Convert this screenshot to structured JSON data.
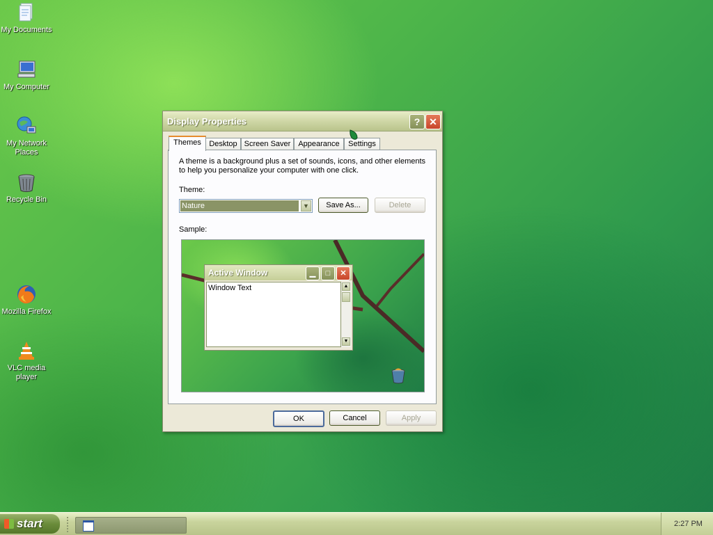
{
  "desktop": {
    "icons": [
      {
        "label": "My Documents",
        "icon": "documents-icon"
      },
      {
        "label": "My Computer",
        "icon": "computer-icon"
      },
      {
        "label_lines": [
          "My Network",
          "Places"
        ],
        "icon": "network-places-icon"
      },
      {
        "label": "Recycle Bin",
        "icon": "recycle-bin-icon"
      },
      {
        "label": "Mozilla Firefox",
        "icon": "firefox-icon"
      },
      {
        "label_lines": [
          "VLC media",
          "player"
        ],
        "icon": "vlc-icon"
      }
    ]
  },
  "dialog": {
    "title": "Display Properties",
    "help_glyph": "?",
    "close_glyph": "✕",
    "tabs": [
      "Themes",
      "Desktop",
      "Screen Saver",
      "Appearance",
      "Settings"
    ],
    "active_tab": "Themes",
    "description": "A theme is a background plus a set of sounds, icons, and other elements to help you personalize your computer with one click.",
    "theme_label": "Theme:",
    "theme_value": "Nature",
    "save_as_label": "Save As...",
    "delete_label": "Delete",
    "sample_label": "Sample:",
    "sample_window": {
      "title": "Active Window",
      "text": "Window Text"
    },
    "ok_label": "OK",
    "cancel_label": "Cancel",
    "apply_label": "Apply"
  },
  "taskbar": {
    "start_label": "start",
    "clock": "2:27 PM"
  },
  "colors": {
    "dialog_face": "#ece9d8",
    "titlebar": "#c5ce98",
    "close_button": "#c8452a",
    "active_tab_accent": "#e68b2c",
    "selected_theme_bg": "#8a9466"
  }
}
